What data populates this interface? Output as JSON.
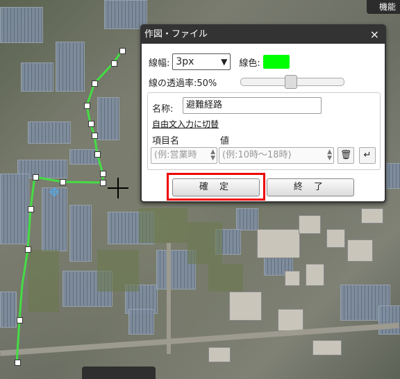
{
  "top_button": {
    "label": "機能"
  },
  "dialog": {
    "title": "作図・ファイル",
    "close": "×",
    "line_width_label": "線幅:",
    "line_width_value": "3px",
    "line_color_label": "線色:",
    "line_color": "#00ff00",
    "opacity_label": "線の透過率:50%",
    "opacity_value": 0.5,
    "name_label": "名称:",
    "name_value": "避難経路",
    "free_text_link": "自由文入力に切替",
    "item_header": "項目名",
    "value_header": "値",
    "item_placeholder": "(例:営業時",
    "value_placeholder": "(例:10時〜18時)",
    "delete_icon": "trash-icon",
    "enter_icon": "enter-icon",
    "ok_button": "確 定",
    "end_button": "終 了"
  },
  "colors": {
    "highlight": "#ee0000",
    "route": "#44dd44"
  }
}
